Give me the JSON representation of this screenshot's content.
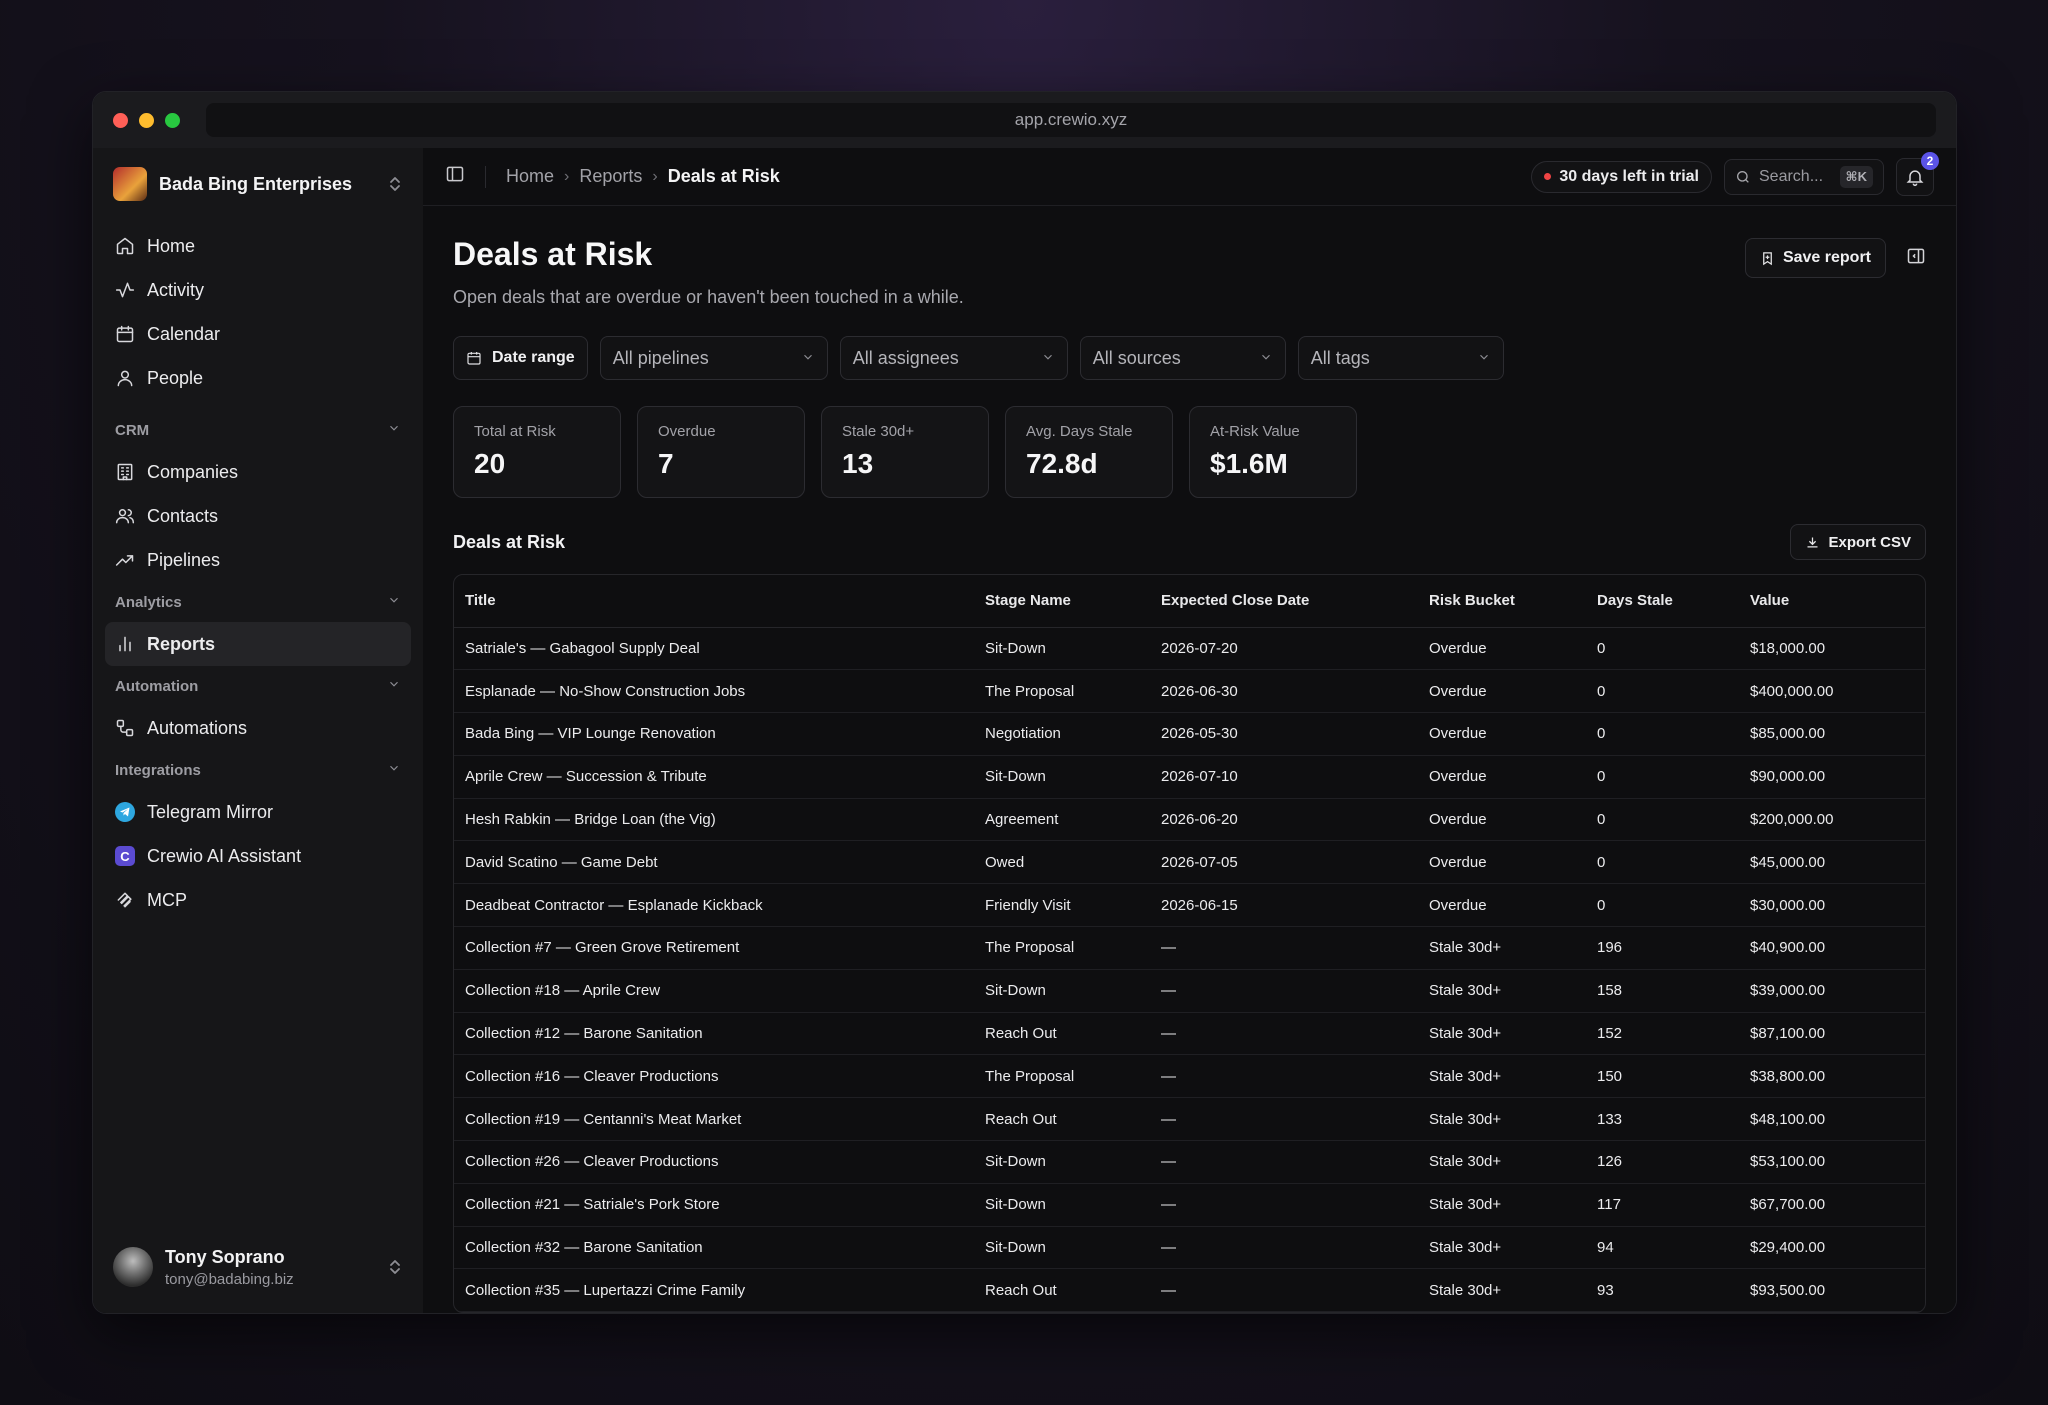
{
  "browser": {
    "url": "app.crewio.xyz"
  },
  "sidebar": {
    "org_name": "Bada Bing Enterprises",
    "main_items": [
      {
        "label": "Home",
        "icon": "home-icon"
      },
      {
        "label": "Activity",
        "icon": "activity-icon"
      },
      {
        "label": "Calendar",
        "icon": "calendar-icon"
      },
      {
        "label": "People",
        "icon": "person-icon"
      }
    ],
    "crm": {
      "label": "CRM",
      "items": [
        {
          "label": "Companies"
        },
        {
          "label": "Contacts"
        },
        {
          "label": "Pipelines"
        }
      ]
    },
    "analytics": {
      "label": "Analytics",
      "items": [
        {
          "label": "Reports",
          "active": true
        }
      ]
    },
    "automation": {
      "label": "Automation",
      "items": [
        {
          "label": "Automations"
        }
      ]
    },
    "integrations": {
      "label": "Integrations",
      "items": [
        {
          "label": "Telegram Mirror"
        },
        {
          "label": "Crewio AI Assistant"
        },
        {
          "label": "MCP"
        }
      ]
    },
    "user": {
      "name": "Tony Soprano",
      "email": "tony@badabing.biz"
    }
  },
  "topbar": {
    "breadcrumbs": [
      "Home",
      "Reports",
      "Deals at Risk"
    ],
    "trial_text": "30 days left in trial",
    "search_placeholder": "Search...",
    "search_shortcut": "⌘K",
    "notification_count": "2"
  },
  "page": {
    "title": "Deals at Risk",
    "subtitle": "Open deals that are overdue or haven't been touched in a while.",
    "save_report_label": "Save report"
  },
  "filters": {
    "date_range": "Date range",
    "pipelines": "All pipelines",
    "assignees": "All assignees",
    "sources": "All sources",
    "tags": "All tags"
  },
  "stats": [
    {
      "label": "Total at Risk",
      "value": "20"
    },
    {
      "label": "Overdue",
      "value": "7"
    },
    {
      "label": "Stale 30d+",
      "value": "13"
    },
    {
      "label": "Avg. Days Stale",
      "value": "72.8d"
    },
    {
      "label": "At-Risk Value",
      "value": "$1.6M"
    }
  ],
  "table": {
    "title": "Deals at Risk",
    "export_label": "Export CSV",
    "columns": [
      "Title",
      "Stage Name",
      "Expected Close Date",
      "Risk Bucket",
      "Days Stale",
      "Value"
    ],
    "rows": [
      [
        "Satriale's — Gabagool Supply Deal",
        "Sit-Down",
        "2026-07-20",
        "Overdue",
        "0",
        "$18,000.00"
      ],
      [
        "Esplanade — No-Show Construction Jobs",
        "The Proposal",
        "2026-06-30",
        "Overdue",
        "0",
        "$400,000.00"
      ],
      [
        "Bada Bing — VIP Lounge Renovation",
        "Negotiation",
        "2026-05-30",
        "Overdue",
        "0",
        "$85,000.00"
      ],
      [
        "Aprile Crew — Succession & Tribute",
        "Sit-Down",
        "2026-07-10",
        "Overdue",
        "0",
        "$90,000.00"
      ],
      [
        "Hesh Rabkin — Bridge Loan (the Vig)",
        "Agreement",
        "2026-06-20",
        "Overdue",
        "0",
        "$200,000.00"
      ],
      [
        "David Scatino — Game Debt",
        "Owed",
        "2026-07-05",
        "Overdue",
        "0",
        "$45,000.00"
      ],
      [
        "Deadbeat Contractor — Esplanade Kickback",
        "Friendly Visit",
        "2026-06-15",
        "Overdue",
        "0",
        "$30,000.00"
      ],
      [
        "Collection #7 — Green Grove Retirement",
        "The Proposal",
        "—",
        "Stale 30d+",
        "196",
        "$40,900.00"
      ],
      [
        "Collection #18 — Aprile Crew",
        "Sit-Down",
        "—",
        "Stale 30d+",
        "158",
        "$39,000.00"
      ],
      [
        "Collection #12 — Barone Sanitation",
        "Reach Out",
        "—",
        "Stale 30d+",
        "152",
        "$87,100.00"
      ],
      [
        "Collection #16 — Cleaver Productions",
        "The Proposal",
        "—",
        "Stale 30d+",
        "150",
        "$38,800.00"
      ],
      [
        "Collection #19 — Centanni's Meat Market",
        "Reach Out",
        "—",
        "Stale 30d+",
        "133",
        "$48,100.00"
      ],
      [
        "Collection #26 — Cleaver Productions",
        "Sit-Down",
        "—",
        "Stale 30d+",
        "126",
        "$53,100.00"
      ],
      [
        "Collection #21 — Satriale's Pork Store",
        "Sit-Down",
        "—",
        "Stale 30d+",
        "117",
        "$67,700.00"
      ],
      [
        "Collection #32 — Barone Sanitation",
        "Sit-Down",
        "—",
        "Stale 30d+",
        "94",
        "$29,400.00"
      ],
      [
        "Collection #35 — Lupertazzi Crime Family",
        "Reach Out",
        "—",
        "Stale 30d+",
        "93",
        "$93,500.00"
      ]
    ]
  }
}
